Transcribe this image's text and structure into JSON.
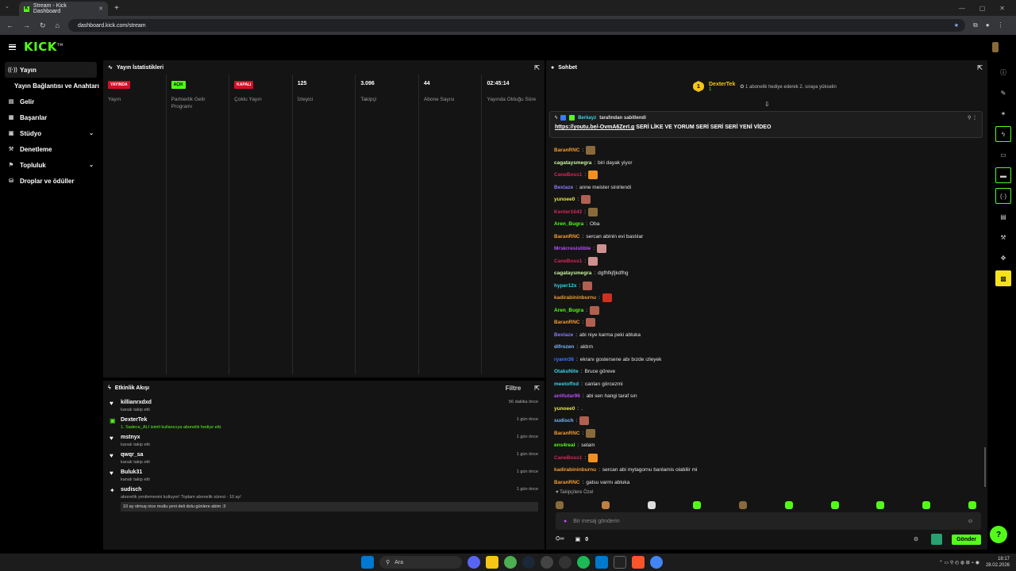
{
  "browser": {
    "tab_title": "Stream - Kick Dashboard",
    "url": "dashboard.kick.com/stream"
  },
  "brand": {
    "logo": "KICK",
    "accent": "#53fc18"
  },
  "sidebar": {
    "items": [
      {
        "label": "Yayın",
        "icon": "broadcast-icon"
      },
      {
        "label": "Yayın Bağlantısı ve Anahtarı",
        "icon": ""
      },
      {
        "label": "Gelir",
        "icon": "revenue-icon"
      },
      {
        "label": "Başarılar",
        "icon": "achievements-icon"
      },
      {
        "label": "Stüdyo",
        "icon": "studio-icon"
      },
      {
        "label": "Denetleme",
        "icon": "moderation-icon"
      },
      {
        "label": "Topluluk",
        "icon": "community-icon"
      },
      {
        "label": "Droplar ve ödüller",
        "icon": "drops-icon"
      }
    ]
  },
  "stats": {
    "title": "Yayın İstatistikleri",
    "cols": [
      {
        "badge": "YAYINDA",
        "badge_type": "red",
        "label": "Yayın"
      },
      {
        "badge": "AÇIK",
        "badge_type": "green",
        "label": "Partnerlik Gelir Programı"
      },
      {
        "badge": "KAPALI",
        "badge_type": "red",
        "label": "Çoklu Yayın"
      },
      {
        "value": "125",
        "label": "İzleyici"
      },
      {
        "value": "3.096",
        "label": "Takipçi"
      },
      {
        "value": "44",
        "label": "Abone Sayısı"
      },
      {
        "value": "02:45:14",
        "label": "Yayında Olduğu Süre"
      }
    ]
  },
  "events": {
    "title": "Etkinlik Akışı",
    "filter": "Filtre",
    "items": [
      {
        "name": "killianrxdxd",
        "desc": "kanalı takip etti",
        "time": "56 dakika önce",
        "icon": "heart-icon"
      },
      {
        "name": "DexterTek",
        "desc": "1. Sadece_ALI isimli kullanıcıya abonelik hediye etti.",
        "time": "1 gün önce",
        "icon": "gift-icon"
      },
      {
        "name": "mstnyx",
        "desc": "kanalı takip etti",
        "time": "1 gün önce",
        "icon": "heart-icon"
      },
      {
        "name": "qwqr_sa",
        "desc": "kanalı takip etti",
        "time": "1 gün önce",
        "icon": "heart-icon"
      },
      {
        "name": "Buluk31",
        "desc": "kanalı takip etti",
        "time": "1 gün önce",
        "icon": "heart-icon"
      },
      {
        "name": "sudisch",
        "desc": "abonelik yenilemesini kutluyor! Toplam abonelik süresi - 10 ay!",
        "time": "1 gün önce",
        "icon": "star-icon",
        "message": "10 ay olmuş nice mutlu yeni deli dolu günlere abim :3"
      }
    ]
  },
  "chat": {
    "title": "Sohbet",
    "goal": {
      "user": "DexterTek",
      "count": "1",
      "text": "1 abonelik hediye ederek 2. sıraya yükselin"
    },
    "pinned": {
      "by": "tarafından sabitlendi",
      "text": "SERİ LİKE VE YORUM SERİ SERİ SERİ YENİ VİDEO",
      "link": "https://youtu.be/-OvmA6ZerI.g"
    },
    "messages": [
      {
        "user": "BaranRNC",
        "color": "#f39c32",
        "text": "",
        "emote": "#8a6a3a"
      },
      {
        "user": "cagataysmegra",
        "color": "#c8f4a0",
        "text": "biri dayak yiyor"
      },
      {
        "user": "CaneBoss1",
        "color": "#d8265a",
        "text": "",
        "emote": "#f09020"
      },
      {
        "user": "Bexlaze",
        "color": "#8a7bff",
        "text": "anne meister sinirlendi"
      },
      {
        "user": "yunoee0",
        "color": "#e8e84a",
        "text": "",
        "emote": "#b06050"
      },
      {
        "user": "Kenter1643",
        "color": "#d8265a",
        "text": "",
        "emote": "#8a6a3a"
      },
      {
        "user": "Aren_Bugra",
        "color": "#53fc18",
        "text": "Oba"
      },
      {
        "user": "BaranRNC",
        "color": "#f39c32",
        "text": "sercan abinin evi bastılar"
      },
      {
        "user": "Mrskrresistible",
        "color": "#b94cff",
        "text": "",
        "emote": "#d09090"
      },
      {
        "user": "CaneBoss1",
        "color": "#d8265a",
        "text": "",
        "emote": "#d09090"
      },
      {
        "user": "cagataysmegra",
        "color": "#c8f4a0",
        "text": "dgfhfkjfjkdfhg"
      },
      {
        "user": "hyper12x",
        "color": "#3ad1e8",
        "text": "",
        "emote": "#b06050"
      },
      {
        "user": "kadirabininburnu",
        "color": "#f39c32",
        "text": "",
        "emote": "#d03020"
      },
      {
        "user": "Aren_Bugra",
        "color": "#53fc18",
        "text": "",
        "emote": "#b06050"
      },
      {
        "user": "BaranRNC",
        "color": "#f39c32",
        "text": "",
        "emote": "#b06050"
      },
      {
        "user": "Bexlaze",
        "color": "#8a7bff",
        "text": "abi niye karma peki abluka"
      },
      {
        "user": "difrozen",
        "color": "#7ab8ff",
        "text": "aldım"
      },
      {
        "user": "ryann36",
        "color": "#3a7bff",
        "text": "ekranı gostersene abı bızde ızleyek"
      },
      {
        "user": "OtakuNite",
        "color": "#3ad1e8",
        "text": "Bruce göreve"
      },
      {
        "user": "meetoffxd",
        "color": "#3ad1e8",
        "text": "canları görcezmi"
      },
      {
        "user": "aniltutar96",
        "color": "#b94cff",
        "text": "abi sen hangi taraf sın"
      },
      {
        "user": "yunoee0",
        "color": "#e8e84a",
        "text": "."
      },
      {
        "user": "sudisch",
        "color": "#7ab8ff",
        "text": "",
        "emote": "#b06050"
      },
      {
        "user": "BaranRNC",
        "color": "#f39c32",
        "text": "",
        "emote": "#8a6a3a"
      },
      {
        "user": "ens4real",
        "color": "#53fc18",
        "text": "selam"
      },
      {
        "user": "CaneBoss1",
        "color": "#d8265a",
        "text": "",
        "emote": "#f09020"
      },
      {
        "user": "kadirabininburnu",
        "color": "#f39c32",
        "text": "sercan abi mytagornu banlamis olabilir mi"
      },
      {
        "user": "BaranRNC",
        "color": "#f39c32",
        "text": "gatsu varmı abluka"
      }
    ],
    "followers_only": "Takipçilere Özel",
    "input_placeholder": "Bir mesaj gönderin",
    "points": "0",
    "send": "Gönder"
  },
  "taskbar": {
    "search": "Ara",
    "time": "18:17",
    "date": "28.02.2026"
  }
}
